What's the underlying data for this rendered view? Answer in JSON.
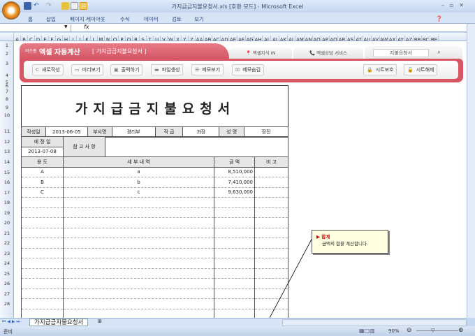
{
  "window": {
    "title": "가지급금지불요청서.xls [호환 모드] - Microsoft Excel"
  },
  "ribbon": {
    "tabs": [
      "홈",
      "삽입",
      "페이지 레이아웃",
      "수식",
      "데이터",
      "검토",
      "보기"
    ]
  },
  "formula_bar": {
    "fx": "fx",
    "name_box": ""
  },
  "columns": [
    "A",
    "B",
    "C",
    "D",
    "E",
    "F",
    "G",
    "H",
    "I",
    "J",
    "K",
    "L",
    "M",
    "N",
    "O",
    "P",
    "Q",
    "R",
    "S",
    "T",
    "U",
    "V",
    "W",
    "X",
    "Y",
    "Z",
    "AA",
    "AB",
    "AC",
    "AD",
    "AE",
    "AF",
    "AG",
    "AH",
    "AI",
    "AJ",
    "AK",
    "AL",
    "AM",
    "AN",
    "AO",
    "AP",
    "AQ",
    "AR",
    "AS",
    "AT",
    "AU",
    "AV",
    "AW",
    "AX",
    "AY",
    "AZ",
    "BB",
    "BC",
    "BE"
  ],
  "banner": {
    "brand_small": "비즈폼",
    "brand": "엑셀 자동계산",
    "doc_name": "[ 가지급금지불요청서 ]",
    "links": [
      "엑셀지식 IN",
      "엑셀상담 서비스"
    ],
    "search_value": "지불요청서",
    "buttons": [
      "새로작성",
      "미리보기",
      "출력하기",
      "파일생성",
      "메모보기",
      "메모숨김"
    ],
    "right_buttons": [
      "시트보호",
      "시트해제"
    ]
  },
  "form": {
    "title": "가지급금지불요청서",
    "labels": {
      "date": "작성일",
      "dept": "부서명",
      "rank": "직 급",
      "name": "성 명",
      "planned": "예 정 일",
      "notes": "참 고 사 항"
    },
    "values": {
      "date": "2013-06-05",
      "dept": "경리부",
      "rank": "과장",
      "name": "장진",
      "planned": "2013-07-08"
    },
    "headers": [
      "용 도",
      "세 부 내 역",
      "금 액",
      "비 고"
    ],
    "rows": [
      {
        "use": "A",
        "detail": "a",
        "amount": "8,510,000",
        "note": ""
      },
      {
        "use": "B",
        "detail": "b",
        "amount": "7,410,000",
        "note": ""
      },
      {
        "use": "C",
        "detail": "c",
        "amount": "9,630,000",
        "note": ""
      }
    ],
    "empty_rows": 12
  },
  "comment": {
    "title": "합계",
    "text": "금액의 합을 계산합니다."
  },
  "sheet_tab": "가지급금지불요청서",
  "status": {
    "ready": "준비",
    "zoom": "90%"
  }
}
